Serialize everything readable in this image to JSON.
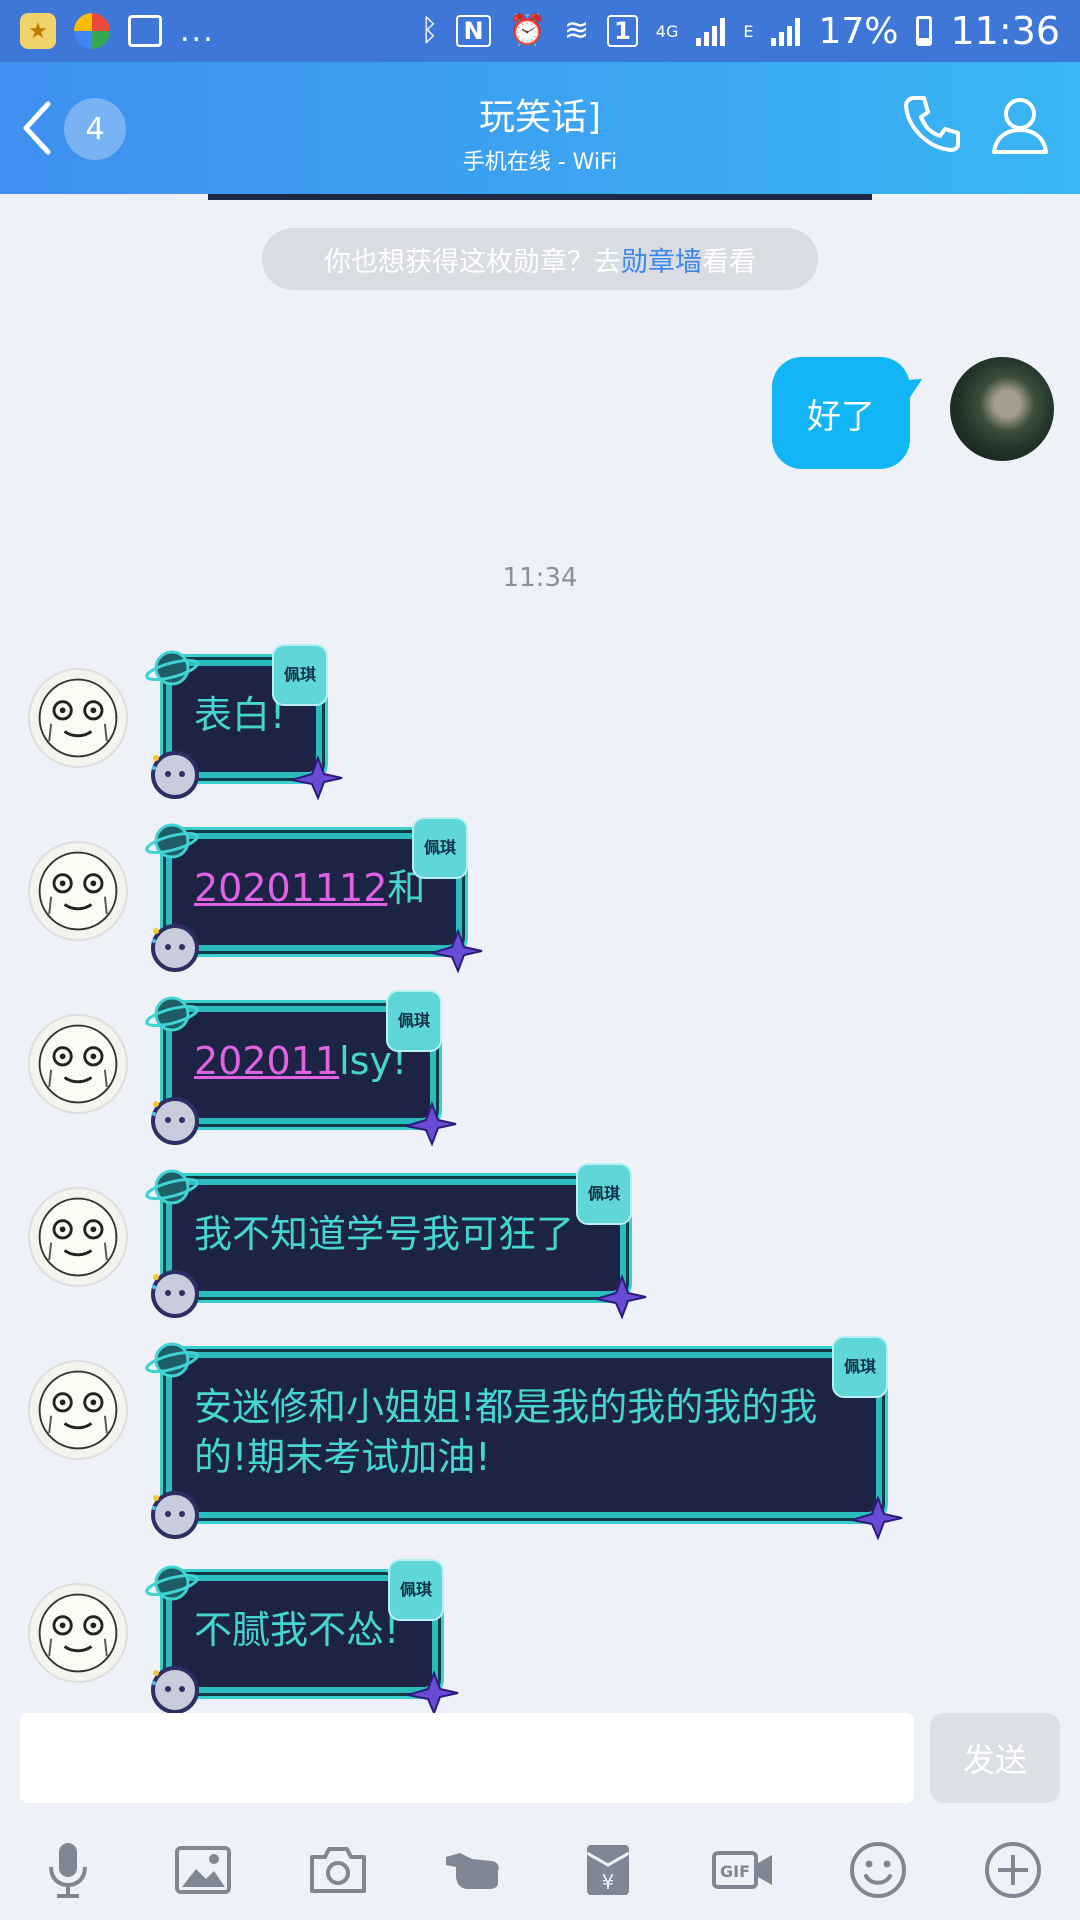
{
  "status_bar": {
    "more": "...",
    "sim_label": "1",
    "network_4g": "4G",
    "network_e": "E",
    "battery": "17%",
    "time": "11:36"
  },
  "header": {
    "unread_count": "4",
    "title": "玩笑话]",
    "subtitle": "手机在线 - WiFi"
  },
  "system_notice": {
    "prefix": "你也想获得这枚勋章？去",
    "link": "勋章墙",
    "suffix": "看看"
  },
  "self_message": {
    "text": "好了"
  },
  "time_divider": "11:34",
  "messages": [
    {
      "tag": "佩琪",
      "text": "表白!"
    },
    {
      "tag": "佩琪",
      "num": "20201112",
      "text": "和"
    },
    {
      "tag": "佩琪",
      "num": "202011",
      "text": "lsy!"
    },
    {
      "tag": "佩琪",
      "text": "我不知道学号我可狂了"
    },
    {
      "tag": "佩琪",
      "text": "安迷修和小姐姐!都是我的我的我的我的!期末考试加油!"
    },
    {
      "tag": "佩琪",
      "text": "不腻我不怂!"
    }
  ],
  "input": {
    "value": "",
    "send_label": "发送"
  },
  "toolbar_icons": [
    "microphone-icon",
    "image-icon",
    "camera-icon",
    "poke-icon",
    "red-packet-icon",
    "gif-icon",
    "emoji-icon",
    "plus-icon"
  ],
  "colors": {
    "header_start": "#3f8ff0",
    "header_end": "#39b6f3",
    "self_bubble": "#12b5f5",
    "theme_bubble_bg": "#1d2345",
    "theme_bubble_text": "#46d6d2",
    "number_link": "#e063e6"
  }
}
